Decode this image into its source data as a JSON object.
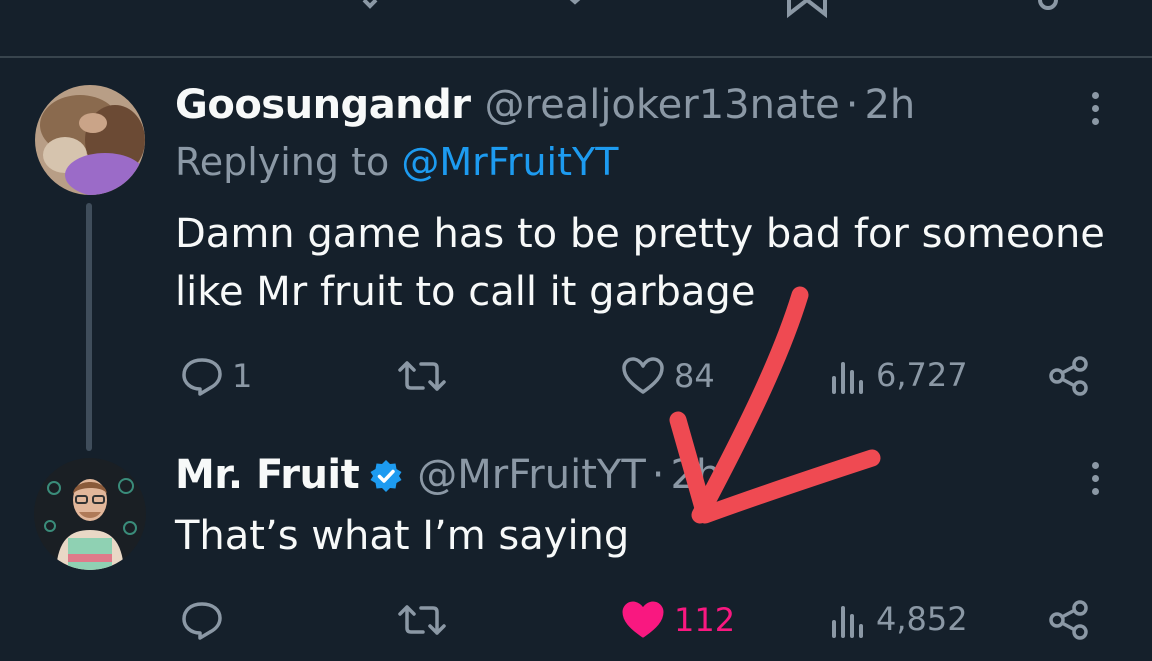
{
  "tweets": [
    {
      "display_name": "Goosungandr",
      "handle": "@realjoker13nate",
      "separator": "·",
      "time": "2h",
      "replying_prefix": "Replying to",
      "replying_to": "@MrFruitYT",
      "text_lines": [
        "Damn game has to be pretty bad for someone",
        "like Mr fruit to call it garbage"
      ],
      "replies": "1",
      "likes": "84",
      "views": "6,727",
      "liked": false
    },
    {
      "display_name": "Mr. Fruit",
      "handle": "@MrFruitYT",
      "separator": "·",
      "time": "2h",
      "verified": true,
      "text_lines": [
        "That’s what I’m saying"
      ],
      "replies": "",
      "likes": "112",
      "views": "4,852",
      "liked": true
    }
  ],
  "colors": {
    "background": "#15202b",
    "text": "#f7f9f9",
    "secondary": "#8b98a5",
    "link": "#1d9bf0",
    "like": "#f91880",
    "annotation_arrow": "#ef4a52"
  },
  "icons": [
    "reply-icon",
    "retweet-icon",
    "like-icon",
    "views-icon",
    "share-icon",
    "more-icon",
    "verified-badge-icon",
    "bookmark-icon"
  ]
}
